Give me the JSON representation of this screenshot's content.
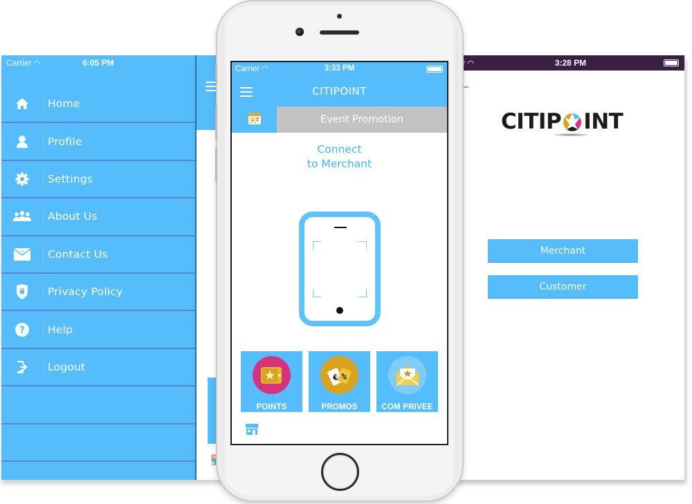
{
  "left_screen": {
    "status": {
      "carrier": "Carrier",
      "time": "6:05 PM"
    },
    "menu": [
      {
        "label": "Home",
        "icon": "home-icon"
      },
      {
        "label": "Profile",
        "icon": "user-icon"
      },
      {
        "label": "Settings",
        "icon": "gear-icon"
      },
      {
        "label": "About Us",
        "icon": "group-icon"
      },
      {
        "label": "Contact Us",
        "icon": "envelope-icon"
      },
      {
        "label": "Privacy Policy",
        "icon": "shield-lock-icon"
      },
      {
        "label": "Help",
        "icon": "question-circle-icon"
      },
      {
        "label": "Logout",
        "icon": "logout-icon"
      }
    ]
  },
  "center_screen": {
    "status": {
      "carrier": "Carrier",
      "time": "3:33 PM"
    },
    "app_title": "CITIPOINT",
    "tab_event": "Event Promotion",
    "connect_line1": "Connect",
    "connect_line2": "to Merchant",
    "tiles": [
      {
        "label": "POINTS",
        "icon": "wallet-star-icon",
        "color": "#d6337f"
      },
      {
        "label": "PROMOS",
        "icon": "price-tags-icon",
        "color": "#d9a320"
      },
      {
        "label": "COM PRIVEE",
        "icon": "envelope-star-icon",
        "color": "#7fcdf7"
      }
    ]
  },
  "right_screen": {
    "status": {
      "carrier": "rier",
      "time": "3:28 PM"
    },
    "logo_left": "CITIP",
    "logo_right": "INT",
    "merchant_button": "Merchant",
    "customer_button": "Customer"
  },
  "colors": {
    "primary": "#55bdfc",
    "tab_gray": "#c2c2c2",
    "status_dark": "#3a1f44",
    "divider": "#5a86c8"
  }
}
